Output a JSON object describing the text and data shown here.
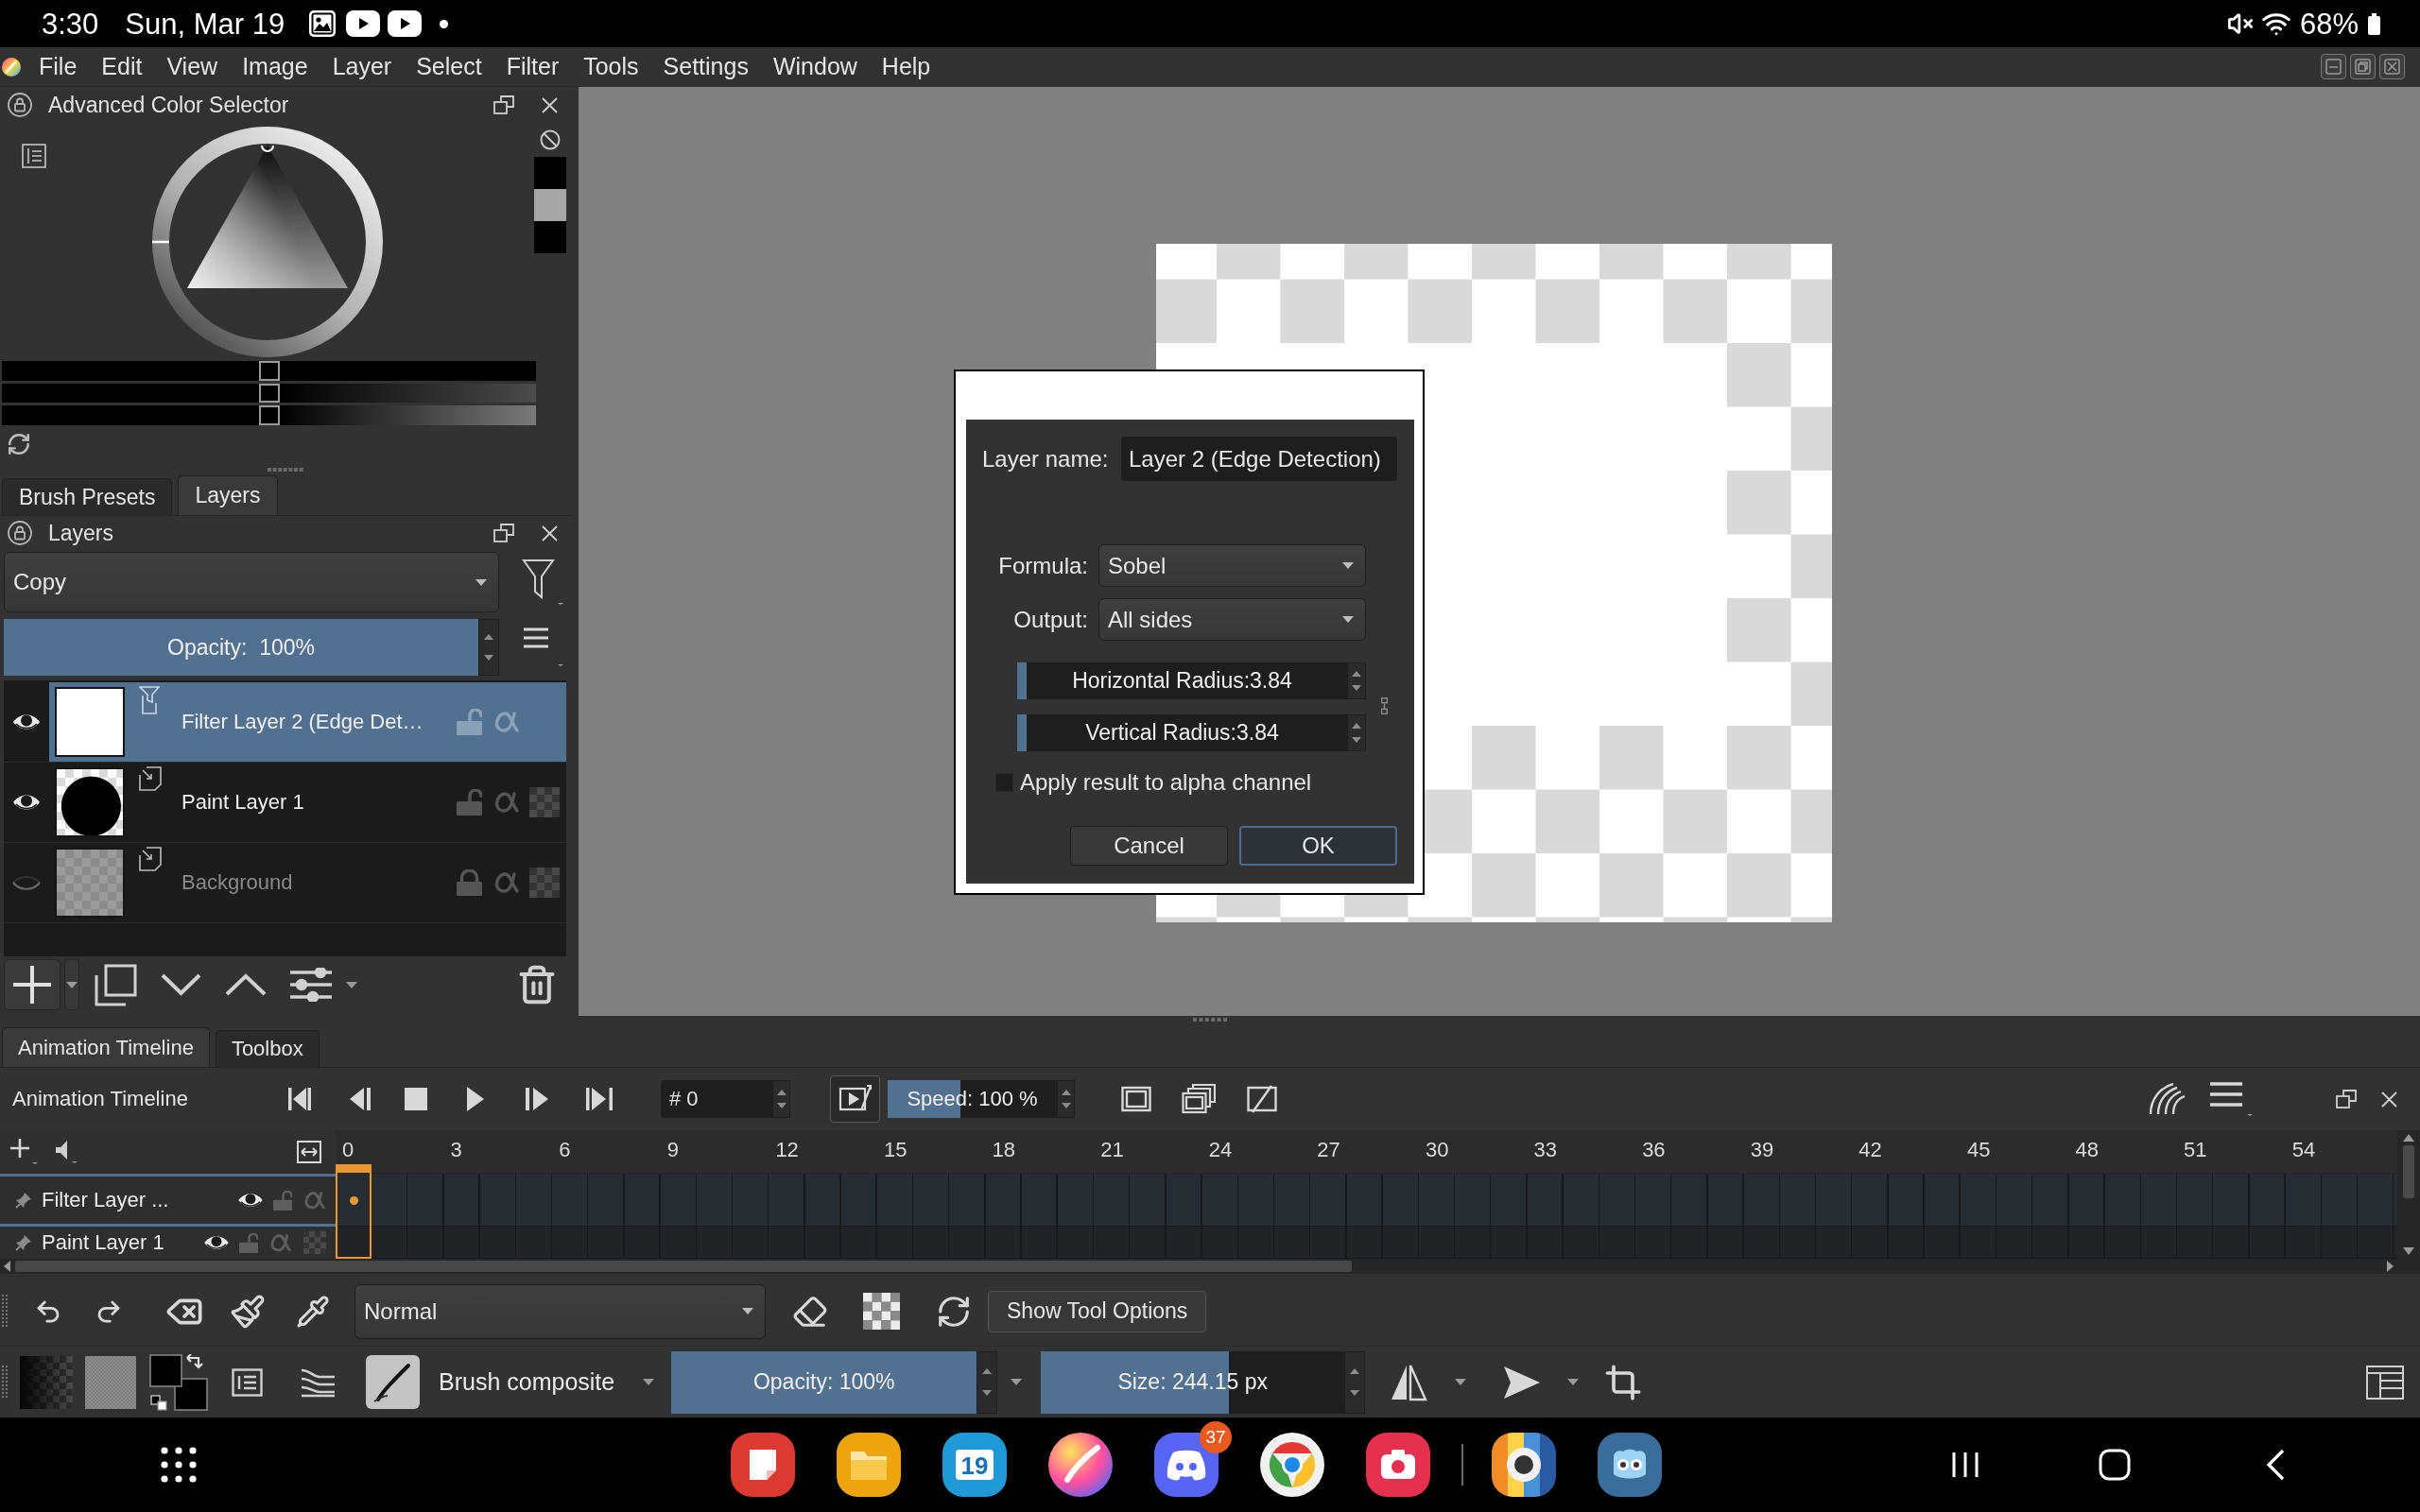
{
  "status_bar": {
    "time": "3:30",
    "date": "Sun, Mar 19",
    "battery": "68%"
  },
  "menu_bar": {
    "items": [
      "File",
      "Edit",
      "View",
      "Image",
      "Layer",
      "Select",
      "Filter",
      "Tools",
      "Settings",
      "Window",
      "Help"
    ]
  },
  "color_selector": {
    "title": "Advanced Color Selector",
    "swatches": [
      {
        "color": "#000000"
      },
      {
        "color": "#a6a6a6"
      },
      {
        "color": "#000000"
      }
    ],
    "sliders": [
      {
        "level": 0.5
      },
      {
        "level": 0.5
      },
      {
        "level": 0.5
      }
    ]
  },
  "dock_tabs": [
    {
      "label": "Brush Presets",
      "selected": false
    },
    {
      "label": "Layers",
      "selected": true
    }
  ],
  "layers_panel": {
    "title": "Layers",
    "blend_mode": "Copy",
    "opacity": {
      "label": "Opacity:  100%",
      "level": 1
    },
    "layers": [
      {
        "name": "Filter Layer 2 (Edge Det…",
        "kind": "filter",
        "thumbnail": {
          "kind": "blank"
        },
        "selected": true,
        "visible": true,
        "locked": false
      },
      {
        "name": "Paint Layer 1",
        "kind": "paint",
        "thumbnail": {
          "kind": "circle"
        },
        "selected": false,
        "visible": true,
        "locked": false
      },
      {
        "name": "Background",
        "kind": "paint",
        "thumbnail": {
          "kind": "transparent"
        },
        "selected": false,
        "visible": false,
        "locked": true
      }
    ]
  },
  "dialog": {
    "name_label": "Layer name:",
    "layer_name": "Layer 2 (Edge Detection)",
    "fields": [
      {
        "label": "Formula:",
        "value": "Sobel"
      },
      {
        "label": "Output:",
        "value": "All sides"
      }
    ],
    "sliders": [
      {
        "label": "Horizontal Radius:3.84",
        "level": 0.03
      },
      {
        "label": "Vertical Radius:3.84",
        "level": 0.03
      }
    ],
    "checkbox": {
      "label": "Apply result to alpha channel",
      "checked": false
    },
    "buttons": [
      {
        "label": "Cancel",
        "default": false
      },
      {
        "label": "OK",
        "default": true
      }
    ]
  },
  "bottom_tabs": [
    {
      "label": "Animation Timeline",
      "selected": true
    },
    {
      "label": "Toolbox",
      "selected": false
    }
  ],
  "timeline": {
    "title": "Animation Timeline",
    "frame_prefix": "#",
    "frame": "0",
    "speed": {
      "label": "Speed: 100 %",
      "level": 0.43
    },
    "frame_numbers": [
      "0",
      "3",
      "6",
      "9",
      "12",
      "15",
      "18",
      "21",
      "24",
      "27",
      "30",
      "33",
      "36",
      "39",
      "42",
      "45",
      "48",
      "51",
      "54"
    ],
    "layers": [
      {
        "name": "Filter Layer ...",
        "kind": "filter",
        "selected": true,
        "visible": true,
        "locked": false,
        "keyframe": true
      },
      {
        "name": "Paint Layer 1",
        "kind": "paint",
        "selected": false,
        "visible": true,
        "locked": false,
        "keyframe": false
      }
    ]
  },
  "tool_options_bar": {
    "blend_mode": "Normal",
    "tool_options_button": "Show Tool Options"
  },
  "brush_bar": {
    "preset": "Brush composite",
    "opacity": {
      "label": "Opacity: 100%",
      "level": 1
    },
    "size": {
      "label": "Size: 244.15 px",
      "level": 0.62
    }
  },
  "nav_bar": {
    "calendar_day": "19",
    "badge": "37"
  }
}
